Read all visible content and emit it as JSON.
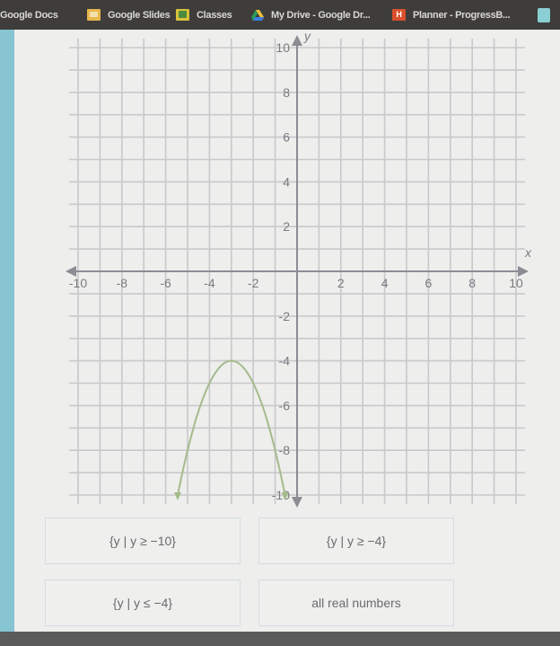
{
  "bookmarks": [
    {
      "label": "Google Docs",
      "icon": "docs-icon"
    },
    {
      "label": "Google Slides",
      "icon": "slides-icon"
    },
    {
      "label": "Classes",
      "icon": "classroom-icon"
    },
    {
      "label": "My Drive - Google Dr...",
      "icon": "drive-icon"
    },
    {
      "label": "Planner - ProgressB...",
      "icon": "planner-icon"
    },
    {
      "label": "",
      "icon": "extension-icon"
    }
  ],
  "graph": {
    "x_axis_label": "x",
    "y_axis_label": "y",
    "x_ticks": [
      "-10",
      "-8",
      "-6",
      "-4",
      "-2",
      "2",
      "4",
      "6",
      "8",
      "10"
    ],
    "y_ticks": [
      "10",
      "8",
      "6",
      "4",
      "2",
      "-2",
      "-4",
      "-6",
      "-8",
      "-10"
    ],
    "colors": {
      "curve": "#a4bb8c",
      "axis": "#8d8c94",
      "grid": "#c9c8cc"
    }
  },
  "chart_data": {
    "type": "line",
    "title": "",
    "xlabel": "x",
    "ylabel": "y",
    "xlim": [
      -10,
      10
    ],
    "ylim": [
      -10,
      10
    ],
    "grid": true,
    "x_ticks": [
      -10,
      -8,
      -6,
      -4,
      -2,
      2,
      4,
      6,
      8,
      10
    ],
    "y_ticks": [
      -10,
      -8,
      -6,
      -4,
      -2,
      2,
      4,
      6,
      8,
      10
    ],
    "series": [
      {
        "name": "parabola",
        "equation": "y = -(x+3)^2 - 4",
        "vertex": [
          -3,
          -4
        ],
        "opens": "down",
        "x": [
          -5.45,
          -5,
          -4.5,
          -4,
          -3.5,
          -3,
          -2.5,
          -2,
          -1.5,
          -1,
          -0.55
        ],
        "y": [
          -10,
          -8,
          -6.25,
          -5,
          -4.25,
          -4,
          -4.25,
          -5,
          -6.25,
          -8,
          -10
        ],
        "arrows_at_ends": true
      }
    ]
  },
  "choices": [
    {
      "label": "{y | y ≥ −10}"
    },
    {
      "label": "{y | y ≥ −4}"
    },
    {
      "label": "{y | y ≤ −4}"
    },
    {
      "label": "all real numbers"
    }
  ]
}
